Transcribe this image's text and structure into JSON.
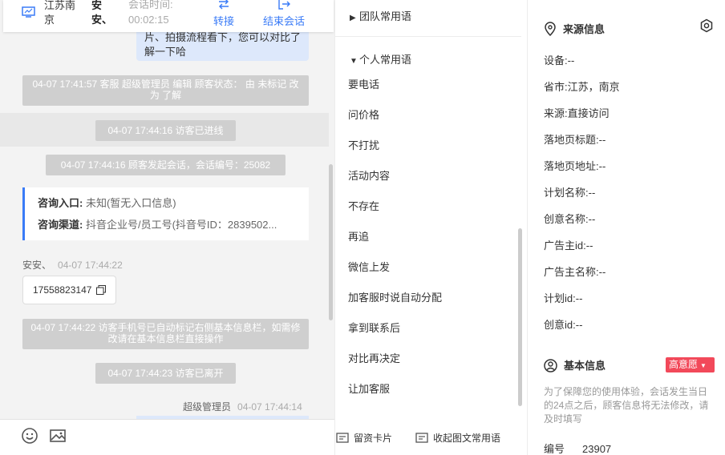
{
  "topbar": {
    "location": "江苏南京",
    "visitor": "安安、",
    "session_label": "会话时间:",
    "session_time": "00:02:15",
    "transfer": "转接",
    "end_session": "结束会话"
  },
  "chat": {
    "my_bubble": "片、拍摄流程看下，您可以对比了解一下哈",
    "sys1": "04-07 17:41:57 客服 超级管理员 编辑 顾客状态： 由 未标记 改为 了解",
    "sys2": "04-07 17:44:16 访客已进线",
    "sys3": "04-07 17:44:16 顾客发起会话，会话编号：25082",
    "card": {
      "entry_label": "咨询入口:",
      "entry_value": "未知(暂无入口信息)",
      "channel_label": "咨询渠道:",
      "channel_value": "抖音企业号/员工号(抖音号ID：2839502..."
    },
    "visitor_name": "安安、",
    "visitor_time": "04-07 17:44:22",
    "phone": "17558823147",
    "sys4": "04-07 17:44:22 访客手机号已自动标记右侧基本信息栏，如需修改请在基本信息栏直接操作",
    "sys5": "04-07 17:44:23 访客已离开",
    "agent_name": "超级管理员",
    "agent_time": "04-07 17:44:14"
  },
  "phrases": {
    "team_group": "团队常用语",
    "personal_group": "个人常用语",
    "items": [
      "要电话",
      "问价格",
      "不打扰",
      "活动内容",
      "不存在",
      "再追",
      "微信上发",
      "加客服时说自动分配",
      "拿到联系后",
      "对比再决定",
      "让加客服"
    ],
    "bottom_card": "留资卡片",
    "bottom_rich": "收起图文常用语"
  },
  "info": {
    "source_title": "来源信息",
    "rows": [
      {
        "label": "设备:",
        "value": "--"
      },
      {
        "label": "省市:",
        "value": "江苏，南京"
      },
      {
        "label": "来源:",
        "value": "直接访问"
      },
      {
        "label": "落地页标题:",
        "value": "--"
      },
      {
        "label": "落地页地址:",
        "value": "--"
      },
      {
        "label": "计划名称:",
        "value": "--"
      },
      {
        "label": "创意名称:",
        "value": "--"
      },
      {
        "label": "广告主id:",
        "value": "--"
      },
      {
        "label": "广告主名称:",
        "value": "--"
      },
      {
        "label": "计划id:",
        "value": "--"
      },
      {
        "label": "创意id:",
        "value": "--"
      }
    ],
    "basic_title": "基本信息",
    "intent_badge": "高意愿",
    "note": "为了保障您的使用体验，会话发生当日的24点之后，顾客信息将无法修改，请及时填写",
    "number_label": "编号",
    "number_value": "23907"
  },
  "colors": {
    "accent": "#3a7bf7",
    "badge": "#f2495a",
    "system_bg": "#cfcfcf",
    "my_bubble": "#dde8fb"
  }
}
